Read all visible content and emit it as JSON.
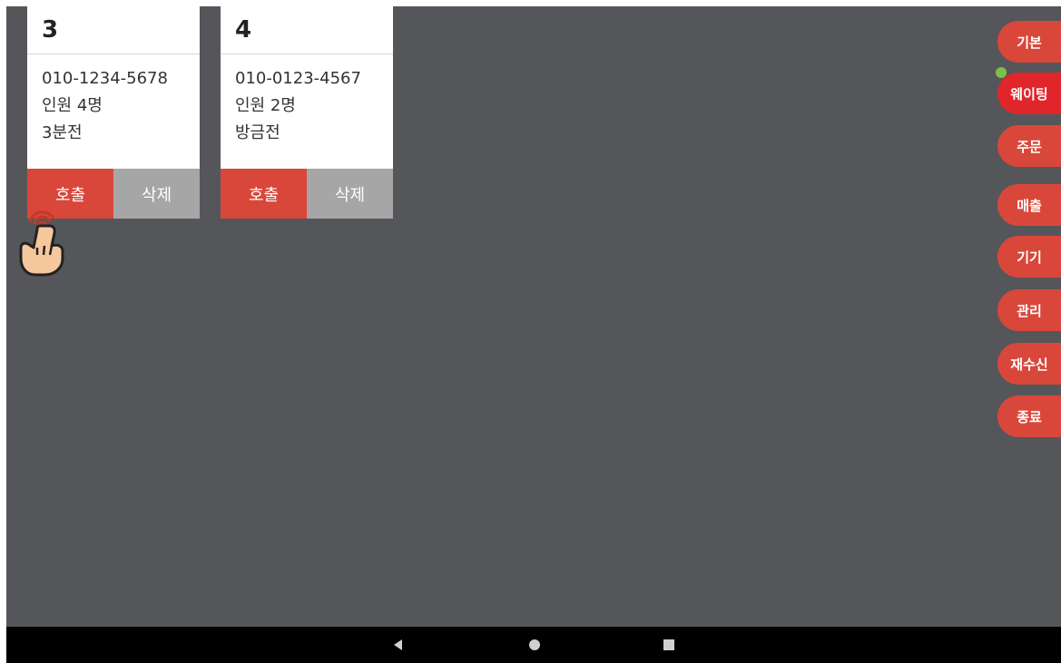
{
  "cards": [
    {
      "number": "3",
      "phone": "010-1234-5678",
      "party": "인원 4명",
      "elapsed": "3분전",
      "call_label": "호출",
      "delete_label": "삭제"
    },
    {
      "number": "4",
      "phone": "010-0123-4567",
      "party": "인원 2명",
      "elapsed": "방금전",
      "call_label": "호출",
      "delete_label": "삭제"
    }
  ],
  "side_menu": {
    "items": [
      {
        "label": "기본"
      },
      {
        "label": "웨이팅",
        "active": true
      },
      {
        "label": "주문"
      },
      {
        "label": "매출"
      },
      {
        "label": "기기"
      },
      {
        "label": "관리"
      },
      {
        "label": "재수신"
      },
      {
        "label": "종료"
      }
    ]
  },
  "colors": {
    "accent_red": "#d9473a",
    "active_red": "#e0262b",
    "delete_gray": "#a6a6a6",
    "background": "#55565a",
    "status_green": "#7bc043"
  },
  "icons": {
    "touch": "tap-hand-icon",
    "nav_back": "back-triangle-icon",
    "nav_home": "home-circle-icon",
    "nav_recents": "recents-square-icon"
  }
}
